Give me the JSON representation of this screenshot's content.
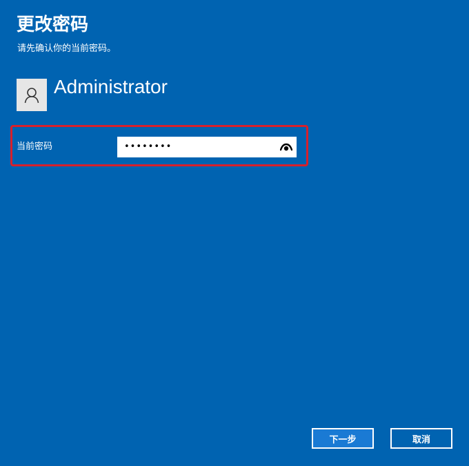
{
  "dialog": {
    "title": "更改密码",
    "subtitle": "请先确认你的当前密码。"
  },
  "user": {
    "name": "Administrator",
    "avatar_icon": "person-icon"
  },
  "form": {
    "current_password_label": "当前密码",
    "current_password_value": "••••••••",
    "reveal_icon": "eye-icon",
    "highlight_color": "#d8202b"
  },
  "buttons": {
    "next_label": "下一步",
    "cancel_label": "取消"
  },
  "colors": {
    "background": "#0063b1",
    "primary_button": "#1a7ad4",
    "text": "#ffffff"
  }
}
